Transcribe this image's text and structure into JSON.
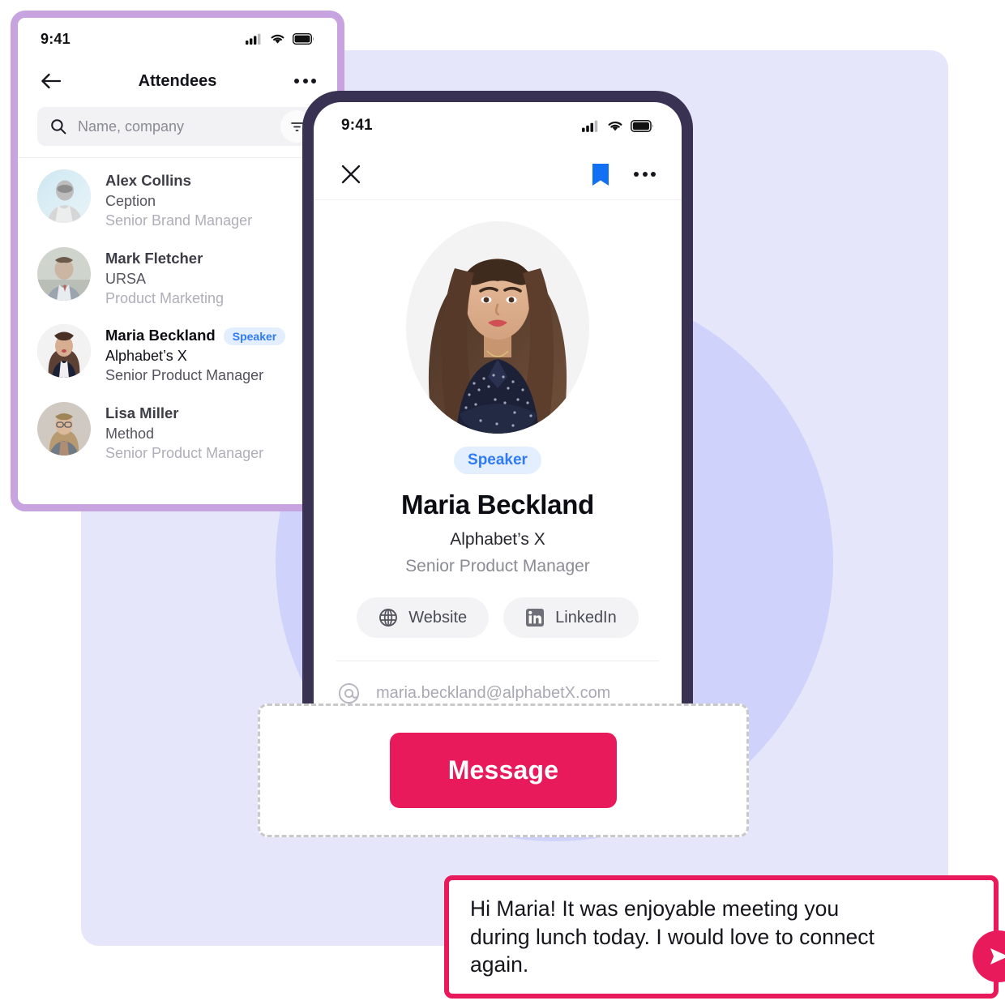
{
  "background": {
    "panel_color": "#E5E6FA",
    "circle_color": "#CFD2FB",
    "accent_pink": "#E81A5C",
    "accent_blue": "#2F7BF6",
    "card_border_purple": "#C7A4E0",
    "phone_bezel": "#3A3252"
  },
  "attendees_screen": {
    "status": {
      "time": "9:41",
      "cellular_icon": "signal-bars-icon",
      "wifi_icon": "wifi-icon",
      "battery_icon": "battery-icon"
    },
    "nav": {
      "back_icon": "arrow-left-icon",
      "title": "Attendees",
      "more_icon": "more-horizontal-icon"
    },
    "search": {
      "icon": "search-icon",
      "placeholder": "Name, company",
      "value": "",
      "filter_icon": "filter-icon"
    },
    "list": [
      {
        "name": "Alex Collins",
        "company": "Ception",
        "role": "Senior Brand Manager",
        "badge": "",
        "avatar": "avatar-alex-collins",
        "selected": false
      },
      {
        "name": "Mark Fletcher",
        "company": "URSA",
        "role": "Product Marketing",
        "badge": "",
        "avatar": "avatar-mark-fletcher",
        "selected": false
      },
      {
        "name": "Maria Beckland",
        "company": "Alphabet’s X",
        "role": "Senior Product Manager",
        "badge": "Speaker",
        "avatar": "avatar-maria-beckland",
        "selected": true
      },
      {
        "name": "Lisa Miller",
        "company": "Method",
        "role": "Senior Product Manager",
        "badge": "",
        "avatar": "avatar-lisa-miller",
        "selected": false
      }
    ]
  },
  "profile_screen": {
    "status": {
      "time": "9:41",
      "cellular_icon": "signal-bars-icon",
      "wifi_icon": "wifi-icon",
      "battery_icon": "battery-icon"
    },
    "nav": {
      "close_icon": "close-icon",
      "bookmark_icon": "bookmark-icon",
      "more_icon": "more-horizontal-icon"
    },
    "photo": "photo-maria-beckland",
    "badge": "Speaker",
    "name": "Maria Beckland",
    "company": "Alphabet’s X",
    "role": "Senior Product Manager",
    "links": [
      {
        "label": "Website",
        "icon": "globe-icon"
      },
      {
        "label": "LinkedIn",
        "icon": "linkedin-icon"
      }
    ],
    "email": {
      "icon": "at-sign-icon",
      "value": "maria.beckland@alphabetX.com"
    }
  },
  "message_card": {
    "button_label": "Message"
  },
  "chat": {
    "text": "Hi Maria! It was enjoyable meeting you during lunch today. I would love to connect again.",
    "send_icon": "send-icon"
  }
}
